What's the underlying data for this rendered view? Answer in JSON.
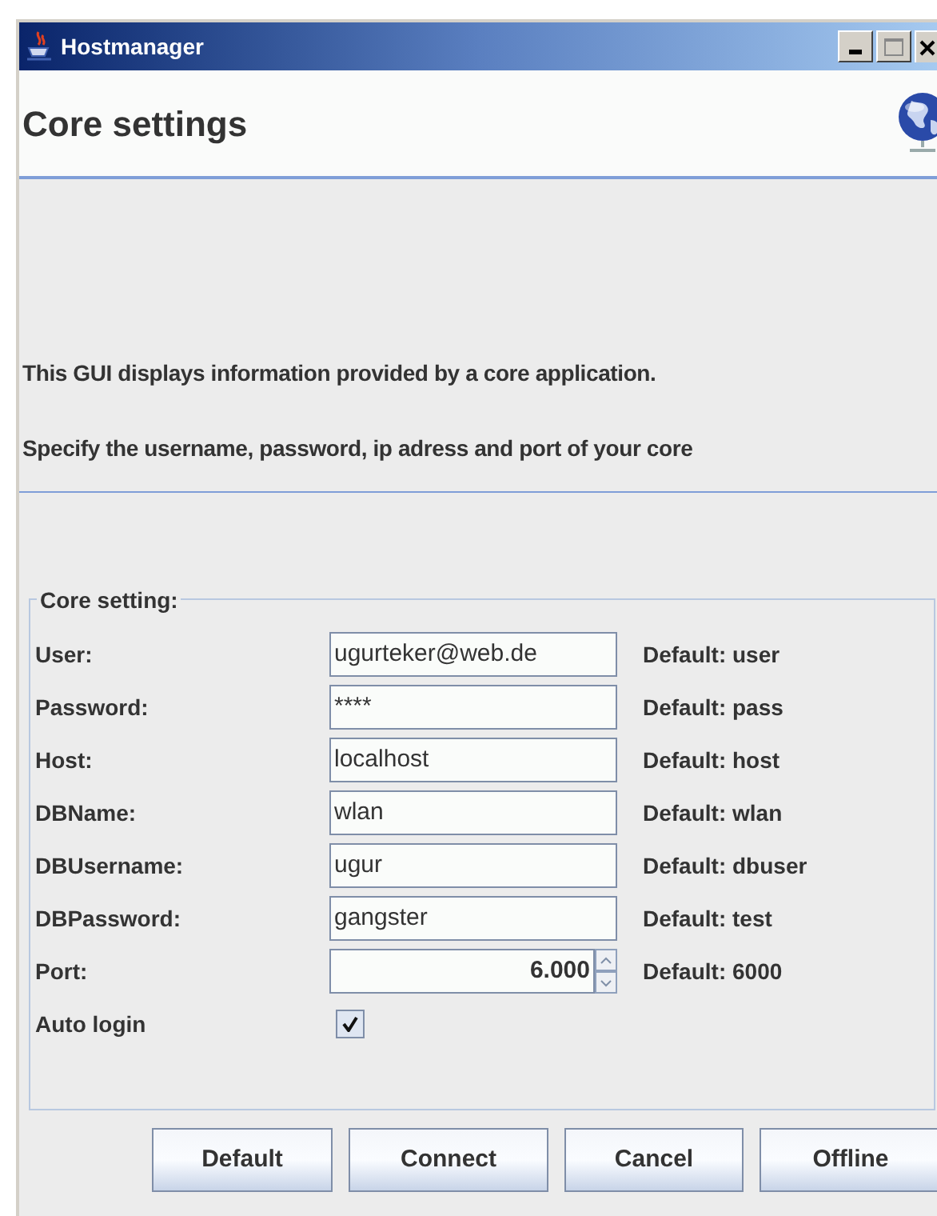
{
  "window": {
    "title": "Hostmanager"
  },
  "header": {
    "title": "Core settings"
  },
  "intro": [
    "This GUI displays information provided by a core application.",
    "Specify the username, password, ip adress and port of your core"
  ],
  "group": {
    "title": "Core setting:",
    "rows": [
      {
        "kind": "text",
        "label": "User:",
        "value": "ugurteker@web.de",
        "default": "Default: user"
      },
      {
        "kind": "text",
        "label": "Password:",
        "value": "****",
        "default": "Default: pass"
      },
      {
        "kind": "text",
        "label": "Host:",
        "value": "localhost",
        "default": "Default: host"
      },
      {
        "kind": "text",
        "label": "DBName:",
        "value": "wlan",
        "default": "Default: wlan"
      },
      {
        "kind": "text",
        "label": "DBUsername:",
        "value": "ugur",
        "default": "Default: dbuser"
      },
      {
        "kind": "text",
        "label": "DBPassword:",
        "value": "gangster",
        "default": "Default: test"
      },
      {
        "kind": "spinner",
        "label": "Port:",
        "value": "6.000",
        "default": "Default: 6000"
      },
      {
        "kind": "checkbox",
        "label": "Auto login",
        "checked": true
      }
    ]
  },
  "buttons": [
    "Default",
    "Connect",
    "Cancel",
    "Offline"
  ]
}
